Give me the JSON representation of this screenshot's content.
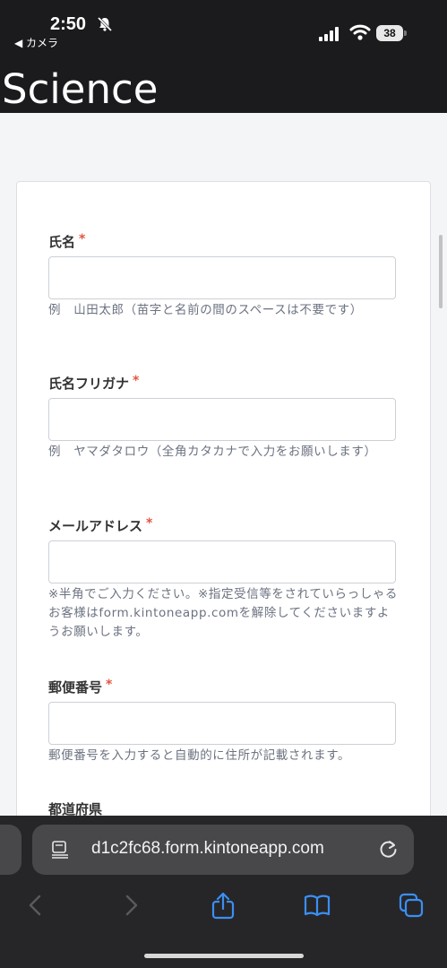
{
  "status_bar": {
    "time": "2:50",
    "back_label": "◀ カメラ",
    "battery": "38"
  },
  "header": {
    "brand": "Science"
  },
  "form": {
    "fields": [
      {
        "label": "氏名",
        "required_mark": "*",
        "value": "",
        "help": "例　山田太郎（苗字と名前の間のスペースは不要です）"
      },
      {
        "label": "氏名フリガナ",
        "required_mark": "*",
        "value": "",
        "help": "例　ヤマダタロウ（全角カタカナで入力をお願いします）"
      },
      {
        "label": "メールアドレス",
        "required_mark": "*",
        "value": "",
        "help": "※半角でご入力ください。※指定受信等をされていらっしゃるお客様はform.kintoneapp.comを解除してくださいますようお願いします。"
      },
      {
        "label": "郵便番号",
        "required_mark": "*",
        "value": "",
        "help": "郵便番号を入力すると自動的に住所が記載されます。"
      },
      {
        "label": "都道府県"
      }
    ]
  },
  "browser": {
    "url": "d1c2fc68.form.kintoneapp.com",
    "toolbar": [
      "back",
      "forward",
      "share",
      "bookmarks",
      "tabs"
    ]
  },
  "colors": {
    "header_bg": "#1b1b1d",
    "required": "#e2553f",
    "accent": "#3b8ff3"
  }
}
